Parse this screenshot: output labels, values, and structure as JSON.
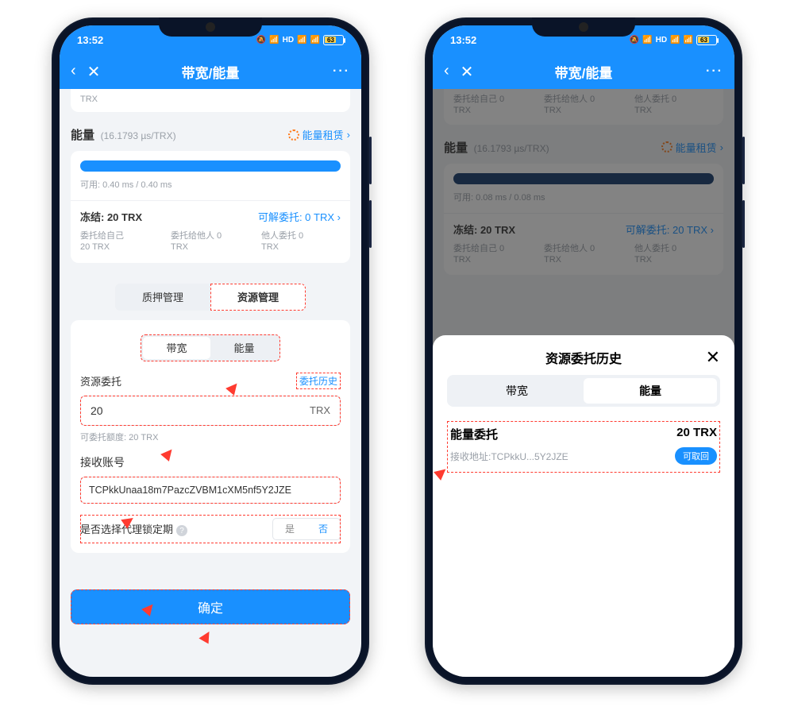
{
  "status": {
    "time": "13:52",
    "battery": "63"
  },
  "header": {
    "title": "带宽/能量"
  },
  "p1": {
    "trx_stub": "TRX",
    "energy": {
      "label": "能量",
      "rate": "(16.1793 µs/TRX)",
      "rent_link": "能量租赁",
      "usable": "可用: 0.40 ms / 0.40 ms",
      "frozen": "冻结: 20 TRX",
      "releasable": "可解委托: 0 TRX",
      "alloc_self_l": "委托给自己",
      "alloc_self_v": "20 TRX",
      "alloc_other_l": "委托给他人 0",
      "alloc_other_v": "TRX",
      "alloc_from_l": "他人委托 0",
      "alloc_from_v": "TRX"
    },
    "tabs": {
      "stake": "质押管理",
      "resource": "资源管理",
      "bw": "带宽",
      "en": "能量"
    },
    "delegate": {
      "title": "资源委托",
      "history_link": "委托历史",
      "amount": "20",
      "unit": "TRX",
      "quota": "可委托额度: 20 TRX"
    },
    "recv": {
      "label": "接收账号",
      "addr": "TCPkkUnaa18m7PazcZVBM1cXM5nf5Y2JZE"
    },
    "lock": {
      "label": "是否选择代理锁定期",
      "yes": "是",
      "no": "否"
    },
    "confirm": "确定"
  },
  "p2": {
    "top_alloc": {
      "a": "委托给自己 0",
      "b": "委托给他人 0",
      "c": "他人委托 0",
      "u": "TRX"
    },
    "energy": {
      "label": "能量",
      "rate": "(16.1793 µs/TRX)",
      "rent_link": "能量租赁",
      "usable": "可用: 0.08 ms / 0.08 ms",
      "frozen": "冻结: 20 TRX",
      "releasable": "可解委托: 20 TRX",
      "alloc_self_l": "委托给自己 0",
      "alloc_self_v": "TRX",
      "alloc_other_l": "委托给他人 0",
      "alloc_other_v": "TRX",
      "alloc_from_l": "他人委托 0",
      "alloc_from_v": "TRX"
    },
    "sheet": {
      "title": "资源委托历史",
      "tab_bw": "带宽",
      "tab_en": "能量",
      "item_title": "能量委托",
      "item_amount": "20 TRX",
      "item_addr": "接收地址:TCPkkU...5Y2JZE",
      "revoke": "可取回"
    }
  }
}
